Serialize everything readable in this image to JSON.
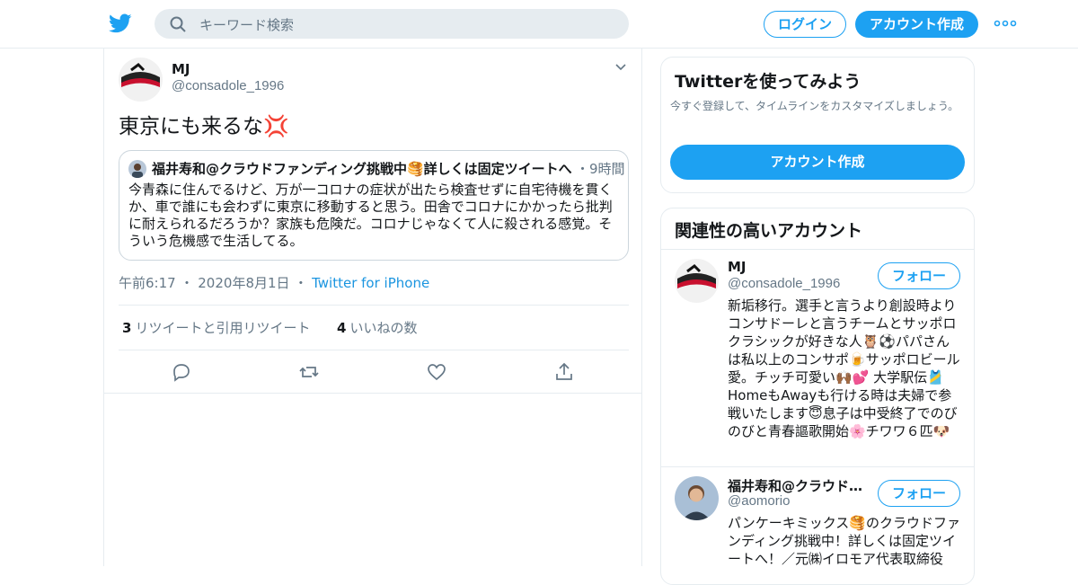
{
  "header": {
    "search_placeholder": "キーワード検索",
    "login_label": "ログイン",
    "signup_label": "アカウント作成"
  },
  "tweet": {
    "author_name": "MJ",
    "author_handle": "@consadole_1996",
    "text": "東京にも来るな",
    "emoji": "💢",
    "quote": {
      "author": "福井寿和@クラウドファンディング挑戦中🥞詳しくは固定ツイートへ",
      "time": "9時間",
      "text": "今青森に住んでるけど、万が一コロナの症状が出たら検査せずに自宅待機を貫くか、車で誰にも会わずに東京に移動すると思う。田舎でコロナにかかったら批判に耐えられるだろうか？家族も危険だ。コロナじゃなくて人に殺される感覚。そういう危機感で生活してる。"
    },
    "time": "午前6:17",
    "date": "2020年8月1日",
    "source": "Twitter for iPhone",
    "retweet_count": "3",
    "retweet_label": "リツイートと引用リツイート",
    "like_count": "4",
    "like_label": "いいねの数"
  },
  "sidebar": {
    "try_card": {
      "title": "Twitterを使ってみよう",
      "subtitle": "今すぐ登録して、タイムラインをカスタマイズしましょう。",
      "button": "アカウント作成"
    },
    "related": {
      "title": "関連性の高いアカウント",
      "follow_label": "フォロー",
      "accounts": [
        {
          "name": "MJ",
          "handle": "@consadole_1996",
          "bio": "新垢移行。選手と言うより創設時よりコンサドーレと言うチームとサッポロクラシックが好きな人🦉⚽パパさんは私以上のコンサポ🍺サッポロビール愛。チッチ可愛い🙌🏾💕 大学駅伝🎽HomeもAwayも行ける時は夫婦で参戦いたします😇息子は中受終了でのびのびと青春謳歌開始🌸チワワ６匹🐶"
        },
        {
          "name": "福井寿和@クラウドファンディング挑戦中",
          "handle": "@aomorio",
          "bio": "パンケーキミックス🥞のクラウドファンディング挑戦中！詳しくは固定ツイートへ！／元㈱イロモア代表取締役"
        }
      ]
    }
  },
  "colors": {
    "accent": "#1da1f2",
    "muted": "#657786",
    "border": "#e6ecf0",
    "link": "#1b95e0"
  }
}
